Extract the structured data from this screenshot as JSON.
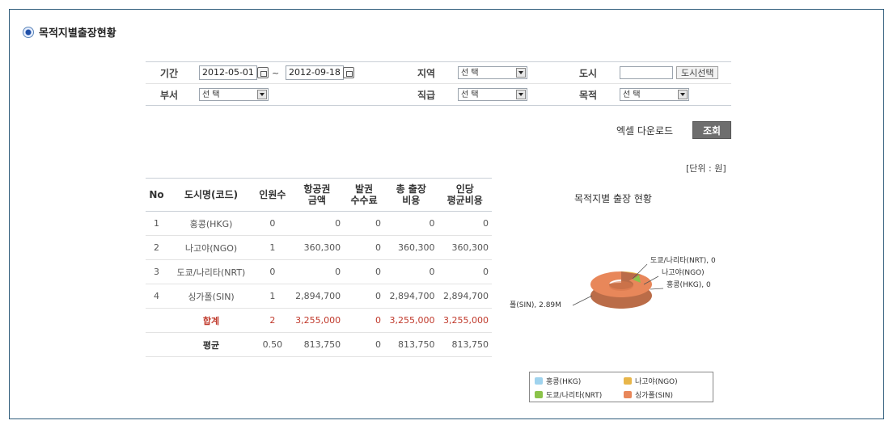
{
  "section": {
    "title": "목적지별출장현황"
  },
  "filters": {
    "period_label": "기간",
    "date_from": "2012-05-01",
    "tilde": "~",
    "date_to": "2012-09-18",
    "region_label": "지역",
    "region_value": "선 택",
    "city_label": "도시",
    "city_button": "도시선택",
    "dept_label": "부서",
    "dept_value": "선 택",
    "rank_label": "직급",
    "rank_value": "선 택",
    "purpose_label": "목적",
    "purpose_value": "선 택"
  },
  "actions": {
    "excel": "엑셀 다운로드",
    "search": "조회"
  },
  "unit": "[단위 : 원]",
  "table": {
    "headers": [
      "No",
      "도시명(코드)",
      "인원수",
      "항공권\n금액",
      "발권\n수수료",
      "총 출장\n비용",
      "인당\n평균비용"
    ],
    "rows": [
      [
        "1",
        "홍콩(HKG)",
        "0",
        "0",
        "0",
        "0",
        "0"
      ],
      [
        "2",
        "나고야(NGO)",
        "1",
        "360,300",
        "0",
        "360,300",
        "360,300"
      ],
      [
        "3",
        "도쿄/나리타(NRT)",
        "0",
        "0",
        "0",
        "0",
        "0"
      ],
      [
        "4",
        "싱가폴(SIN)",
        "1",
        "2,894,700",
        "0",
        "2,894,700",
        "2,894,700"
      ]
    ],
    "total": [
      "",
      "합계",
      "2",
      "3,255,000",
      "0",
      "3,255,000",
      "3,255,000"
    ],
    "average": [
      "",
      "평균",
      "0.50",
      "813,750",
      "0",
      "813,750",
      "813,750"
    ]
  },
  "chart_data": {
    "type": "pie",
    "title": "목적지별 출장 현황",
    "categories": [
      "홍콩(HKG)",
      "나고야(NGO)",
      "도쿄/나리타(NRT)",
      "싱가폴(SIN)"
    ],
    "values": [
      0,
      360300,
      0,
      2894700
    ],
    "labels": [
      "홍콩(HKG), 0",
      "나고야(NGO)",
      "도쿄/나리타(NRT), 0",
      "폴(SIN), 2.89M"
    ],
    "colors": [
      "#9fd3ee",
      "#e8b64a",
      "#8bc34a",
      "#e8875a"
    ],
    "legend": [
      "홍콩(HKG)",
      "나고야(NGO)",
      "도쿄/나리타(NRT)",
      "싱가폴(SIN)"
    ]
  }
}
